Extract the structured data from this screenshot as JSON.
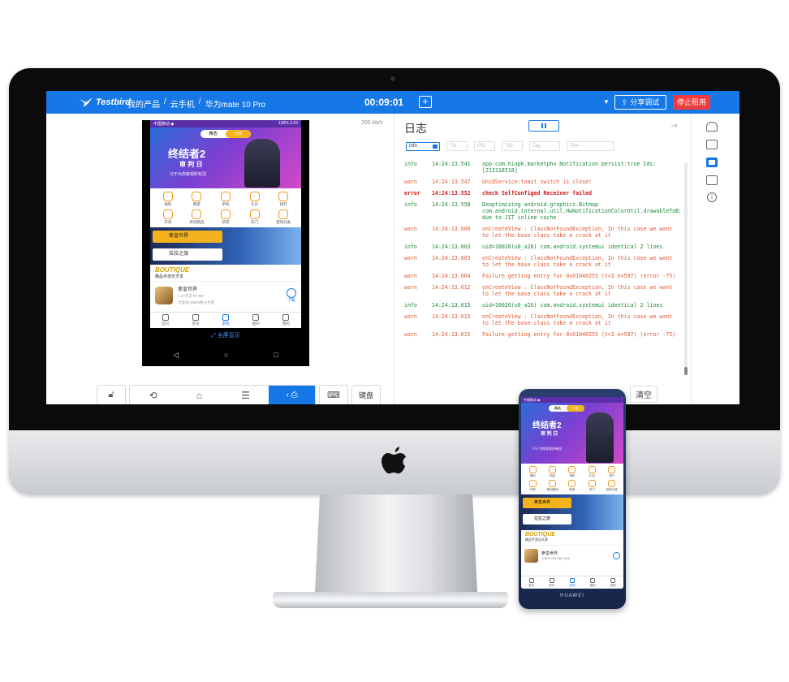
{
  "app": {
    "logo_text": "Testbird",
    "breadcrumb": [
      "我的产品",
      "/",
      "云手机",
      "/",
      "华为mate 10 Pro"
    ],
    "timer": "00:09:01",
    "share_label": "分享调试",
    "stop_label": "停止租用"
  },
  "viewer": {
    "speed": "200 kb/s",
    "fullscreen_label": "全屏显示",
    "keyboard_label": "键盘"
  },
  "phone_screen": {
    "status_left": "中国移动 ◆",
    "status_right": "100% 2:24",
    "tabs": [
      "精选",
      "分类"
    ],
    "banner_title_1": "终结者2",
    "banner_title_2": "审 判 日",
    "banner_sub": "只于为你家现所有冠",
    "grid": [
      "福利",
      "网游",
      "单机",
      "礼包",
      "排行",
      "开测",
      "原创精选",
      "新游",
      "热门",
      "游戏分类"
    ],
    "game_1": "拳皇世界",
    "game_2": "拉拉之旅",
    "boutique": "BOUTIQUE",
    "boutique_sub": "精品手游天天享",
    "featured_name": "拳皇世界",
    "featured_meta": "大型3D MMO格斗手游",
    "featured_size": "1.27万次 97.6M",
    "download": "下载",
    "nav": [
      "首页",
      "资讯",
      "游戏",
      "福利",
      "我的"
    ],
    "brand": "HUAWEI"
  },
  "log_panel": {
    "title": "日志",
    "level_filter": "info",
    "filter_placeholders": [
      "Tid",
      "PID",
      "TID",
      "Tag",
      "Text"
    ],
    "clear_label": "清空",
    "entries": [
      {
        "level": "info",
        "time": "14:24:13.541",
        "msg": "app:com.hiapk.marketpho Notification persist:true  Ids:[213116518]"
      },
      {
        "level": "warn",
        "time": "14:24:13.547",
        "msg": "UnidService:toast switch is close!"
      },
      {
        "level": "error",
        "time": "14:24:13.552",
        "msg": "check SelfConfiged Receiver failed"
      },
      {
        "level": "info",
        "time": "14:24:13.558",
        "msg": "Deoptimizing android.graphics.Bitmap com.android.internal.util.HwNotificationColorUtil.drawableToBitmap(android.graphics.drawable.Drawable) due to JIT inline cache"
      },
      {
        "level": "warn",
        "time": "14:24:13.600",
        "msg": "onCreateView : ClassNotFoundException, In this case we want to let the base class take a crack at it"
      },
      {
        "level": "info",
        "time": "14:24:13.603",
        "msg": "uid=10026(u0_a26) com.android.systemui identical 2 lines"
      },
      {
        "level": "warn",
        "time": "14:24:13.603",
        "msg": "onCreateView : ClassNotFoundException, In this case we want to let the base class take a crack at it"
      },
      {
        "level": "warn",
        "time": "14:24:13.604",
        "msg": "Failure getting entry for 0x01040255 (t=3 e=597) (error -75)"
      },
      {
        "level": "warn",
        "time": "14:24:13.612",
        "msg": "onCreateView : ClassNotFoundException, In this case we want to let the base class take a crack at it"
      },
      {
        "level": "info",
        "time": "14:24:13.615",
        "msg": "uid=10026(u0_a26) com.android.systemui identical 2 lines"
      },
      {
        "level": "warn",
        "time": "14:24:13.615",
        "msg": "onCreateView : ClassNotFoundException, In this case we want to let the base class take a crack at it"
      },
      {
        "level": "warn",
        "time": "14:24:13.615",
        "msg": "Failure getting entry for 0x01040255 (t=3 e=597) (error -75)"
      }
    ]
  },
  "colors": {
    "accent": "#1677e6",
    "stop": "#ef3b3b",
    "info": "#1a8a3a",
    "warn": "#e4572e",
    "error": "#d41111"
  },
  "icons": [
    "bird-logo-icon",
    "plus-icon",
    "share-icon",
    "lock-icon",
    "back-icon",
    "home-icon",
    "menu-icon",
    "screenshot-icon",
    "keyboard-icon",
    "pause-icon",
    "cloud-icon",
    "image-icon",
    "screen-icon",
    "terminal-icon",
    "info-icon",
    "apple-logo-icon"
  ]
}
